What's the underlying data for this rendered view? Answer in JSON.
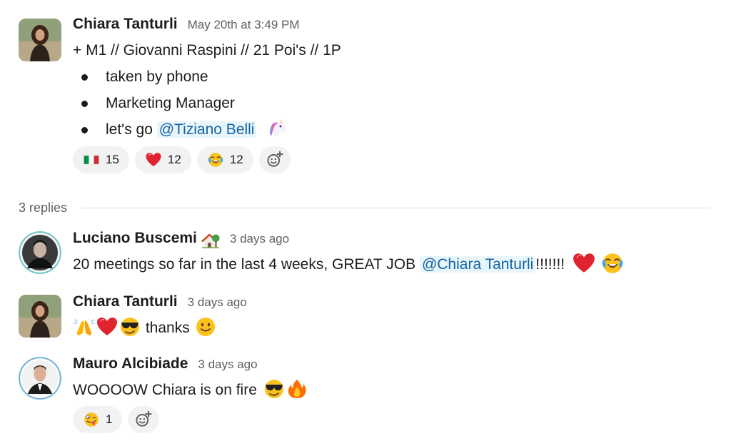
{
  "thread": {
    "parent": {
      "author": "Chiara Tanturli",
      "time": "May 20th at 3:49 PM",
      "text_line": "+ M1 // Giovanni Raspini // 21 Poi's // 1P",
      "bullets": [
        {
          "text": "taken by phone"
        },
        {
          "text": "Marketing Manager"
        },
        {
          "text_before": "let's go ",
          "mention": "@Tiziano Belli"
        }
      ],
      "reactions": [
        {
          "emoji": "italy-flag-icon",
          "count": "15"
        },
        {
          "emoji": "red-heart-icon",
          "count": "12"
        },
        {
          "emoji": "tears-of-joy-icon",
          "count": "12"
        }
      ]
    },
    "replies_label": "3 replies",
    "replies": [
      {
        "author": "Luciano Buscemi",
        "status_icon": "house-with-garden-icon",
        "time": "3 days ago",
        "text_before": "20 meetings so far in the last 4 weeks, GREAT JOB ",
        "mention": "@Chiara Tanturli",
        "text_after": "!!!!!!!"
      },
      {
        "author": "Chiara Tanturli",
        "time": "3 days ago",
        "text": "thanks"
      },
      {
        "author": "Mauro Alcibiade",
        "time": "3 days ago",
        "text": "WOOOOW Chiara is on fire",
        "reactions": [
          {
            "emoji": "zany-face-icon",
            "count": "1"
          }
        ]
      }
    ]
  },
  "colors": {
    "mention_bg": "#e8f5fa",
    "mention_text": "#1264a3",
    "reaction_bg": "#f2f2f2",
    "timestamp": "#616061"
  }
}
